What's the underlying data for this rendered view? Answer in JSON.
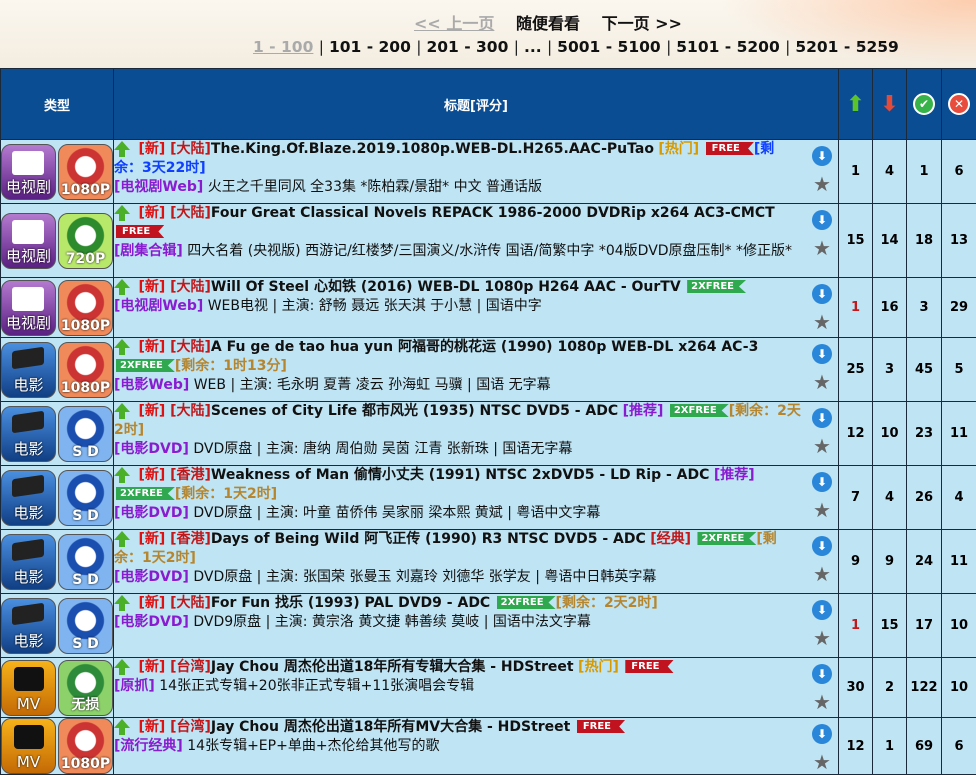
{
  "pager": {
    "prev": "<< 上一页",
    "random": "随便看看",
    "next": "下一页 >>",
    "ranges": [
      "1 - 100",
      "101 - 200",
      "201 - 300",
      "...",
      "5001 - 5100",
      "5101 - 5200",
      "5201 - 5259"
    ]
  },
  "headers": {
    "type": "类型",
    "title": "标题[评分]",
    "seeders_icon": "up-arrow-icon",
    "leechers_icon": "down-arrow-icon",
    "completed_icon": "check-icon",
    "rejected_icon": "x-icon"
  },
  "rows": [
    {
      "cat": "电视剧",
      "cat_kind": "tv",
      "res": "1080P",
      "res_kind": "r1080",
      "new": "[新]",
      "region": "[大陆]",
      "title": "The.King.Of.Blaze.2019.1080p.WEB-DL.H265.AAC-PuTao",
      "tag": "[热门]",
      "tag_kind": "hot",
      "promo": "FREE",
      "promo_kind": "free",
      "remain": "[剩余：3天22时]",
      "remain_kind": "blue",
      "subcat": "[电视剧Web]",
      "desc": "火王之千里同风 全33集 *陈柏霖/景甜* 中文 普通话版",
      "s": "1",
      "l": "4",
      "c": "1",
      "x": "6",
      "s_red": false
    },
    {
      "cat": "电视剧",
      "cat_kind": "tv",
      "res": "720P",
      "res_kind": "r720",
      "new": "[新]",
      "region": "[大陆]",
      "title": "Four Great Classical Novels REPACK 1986-2000 DVDRip x264 AC3-CMCT",
      "tag": "",
      "tag_kind": "",
      "promo": "FREE",
      "promo_kind": "free",
      "remain": "",
      "remain_kind": "",
      "subcat": "[剧集合辑]",
      "desc": "四大名着 (央视版) 西游记/红楼梦/三国演义/水浒传 国语/简繁中字 *04版DVD原盘压制* *修正版*",
      "s": "15",
      "l": "14",
      "c": "18",
      "x": "13",
      "s_red": false
    },
    {
      "cat": "电视剧",
      "cat_kind": "tv",
      "res": "1080P",
      "res_kind": "r1080",
      "new": "[新]",
      "region": "[大陆]",
      "title": "Will Of Steel 心如铁 (2016) WEB-DL 1080p H264 AAC - OurTV",
      "tag": "",
      "tag_kind": "",
      "promo": "2XFREE",
      "promo_kind": "x2free",
      "remain": "",
      "remain_kind": "",
      "subcat": "[电视剧Web]",
      "desc": "WEB电视 | 主演: 舒畅 聂远 张天淇 于小慧 | 国语中字",
      "s": "1",
      "l": "16",
      "c": "3",
      "x": "29",
      "s_red": true
    },
    {
      "cat": "电影",
      "cat_kind": "film",
      "res": "1080P",
      "res_kind": "r1080",
      "new": "[新]",
      "region": "[大陆]",
      "title": "A Fu ge de tao hua yun 阿福哥的桃花运 (1990) 1080p WEB-DL x264 AC-3",
      "tag": "",
      "tag_kind": "",
      "promo": "2XFREE",
      "promo_kind": "x2free",
      "remain": "[剩余：1时13分]",
      "remain_kind": "gold",
      "subcat": "[电影Web]",
      "desc": "WEB | 主演: 毛永明 夏菁 凌云 孙海虹 马骥 | 国语 无字幕",
      "s": "25",
      "l": "3",
      "c": "45",
      "x": "5",
      "s_red": false
    },
    {
      "cat": "电影",
      "cat_kind": "film",
      "res": "S D",
      "res_kind": "rsd",
      "new": "[新]",
      "region": "[大陆]",
      "title": "Scenes of City Life 都市风光 (1935) NTSC DVD5 - ADC",
      "tag": "[推荐]",
      "tag_kind": "rec",
      "promo": "2XFREE",
      "promo_kind": "x2free",
      "remain": "[剩余：2天2时]",
      "remain_kind": "gold",
      "subcat": "[电影DVD]",
      "desc": "DVD原盘 | 主演: 唐纳 周伯勋 吴茵 江青 张新珠 | 国语无字幕",
      "s": "12",
      "l": "10",
      "c": "23",
      "x": "11",
      "s_red": false
    },
    {
      "cat": "电影",
      "cat_kind": "film",
      "res": "S D",
      "res_kind": "rsd",
      "new": "[新]",
      "region": "[香港]",
      "title": "Weakness of Man 偷情小丈夫 (1991) NTSC 2xDVD5 - LD Rip - ADC",
      "tag": "[推荐]",
      "tag_kind": "rec",
      "promo": "2XFREE",
      "promo_kind": "x2free",
      "remain": "[剩余：1天2时]",
      "remain_kind": "gold",
      "subcat": "[电影DVD]",
      "desc": "DVD原盘 | 主演: 叶童 苗侨伟 吴家丽 梁本熙 黄斌 | 粤语中文字幕",
      "s": "7",
      "l": "4",
      "c": "26",
      "x": "4",
      "s_red": false
    },
    {
      "cat": "电影",
      "cat_kind": "film",
      "res": "S D",
      "res_kind": "rsd",
      "new": "[新]",
      "region": "[香港]",
      "title": "Days of Being Wild 阿飞正传 (1990) R3 NTSC DVD5 - ADC",
      "tag": "[经典]",
      "tag_kind": "cls",
      "promo": "2XFREE",
      "promo_kind": "x2free",
      "remain": "[剩余：1天2时]",
      "remain_kind": "gold",
      "subcat": "[电影DVD]",
      "desc": "DVD原盘 | 主演: 张国荣 张曼玉 刘嘉玲 刘德华 张学友 | 粤语中日韩英字幕",
      "s": "9",
      "l": "9",
      "c": "24",
      "x": "11",
      "s_red": false
    },
    {
      "cat": "电影",
      "cat_kind": "film",
      "res": "S D",
      "res_kind": "rsd",
      "new": "[新]",
      "region": "[大陆]",
      "title": "For Fun 找乐 (1993) PAL DVD9 - ADC",
      "tag": "",
      "tag_kind": "",
      "promo": "2XFREE",
      "promo_kind": "x2free",
      "remain": "[剩余：2天2时]",
      "remain_kind": "gold",
      "subcat": "[电影DVD]",
      "desc": "DVD9原盘 | 主演: 黄宗洛 黄文捷 韩善续 莫岐 | 国语中法文字幕",
      "s": "1",
      "l": "15",
      "c": "17",
      "x": "10",
      "s_red": true
    },
    {
      "cat": "MV",
      "cat_kind": "mv",
      "res": "无损",
      "res_kind": "rwu",
      "new": "[新]",
      "region": "[台湾]",
      "title": "Jay Chou 周杰伦出道18年所有专辑大合集 - HDStreet",
      "tag": "[热门]",
      "tag_kind": "hot",
      "promo": "FREE",
      "promo_kind": "free",
      "remain": "",
      "remain_kind": "",
      "subcat": "[原抓]",
      "desc": "14张正式专辑+20张非正式专辑+11张演唱会专辑",
      "s": "30",
      "l": "2",
      "c": "122",
      "x": "10",
      "s_red": false
    },
    {
      "cat": "MV",
      "cat_kind": "mv",
      "res": "1080P",
      "res_kind": "r1080",
      "new": "[新]",
      "region": "[台湾]",
      "title": "Jay Chou 周杰伦出道18年所有MV大合集 - HDStreet",
      "tag": "",
      "tag_kind": "",
      "promo": "FREE",
      "promo_kind": "free",
      "remain": "",
      "remain_kind": "",
      "subcat": "[流行经典]",
      "desc": "14张专辑+EP+单曲+杰伦给其他写的歌",
      "s": "12",
      "l": "1",
      "c": "69",
      "x": "6",
      "s_red": false
    }
  ]
}
